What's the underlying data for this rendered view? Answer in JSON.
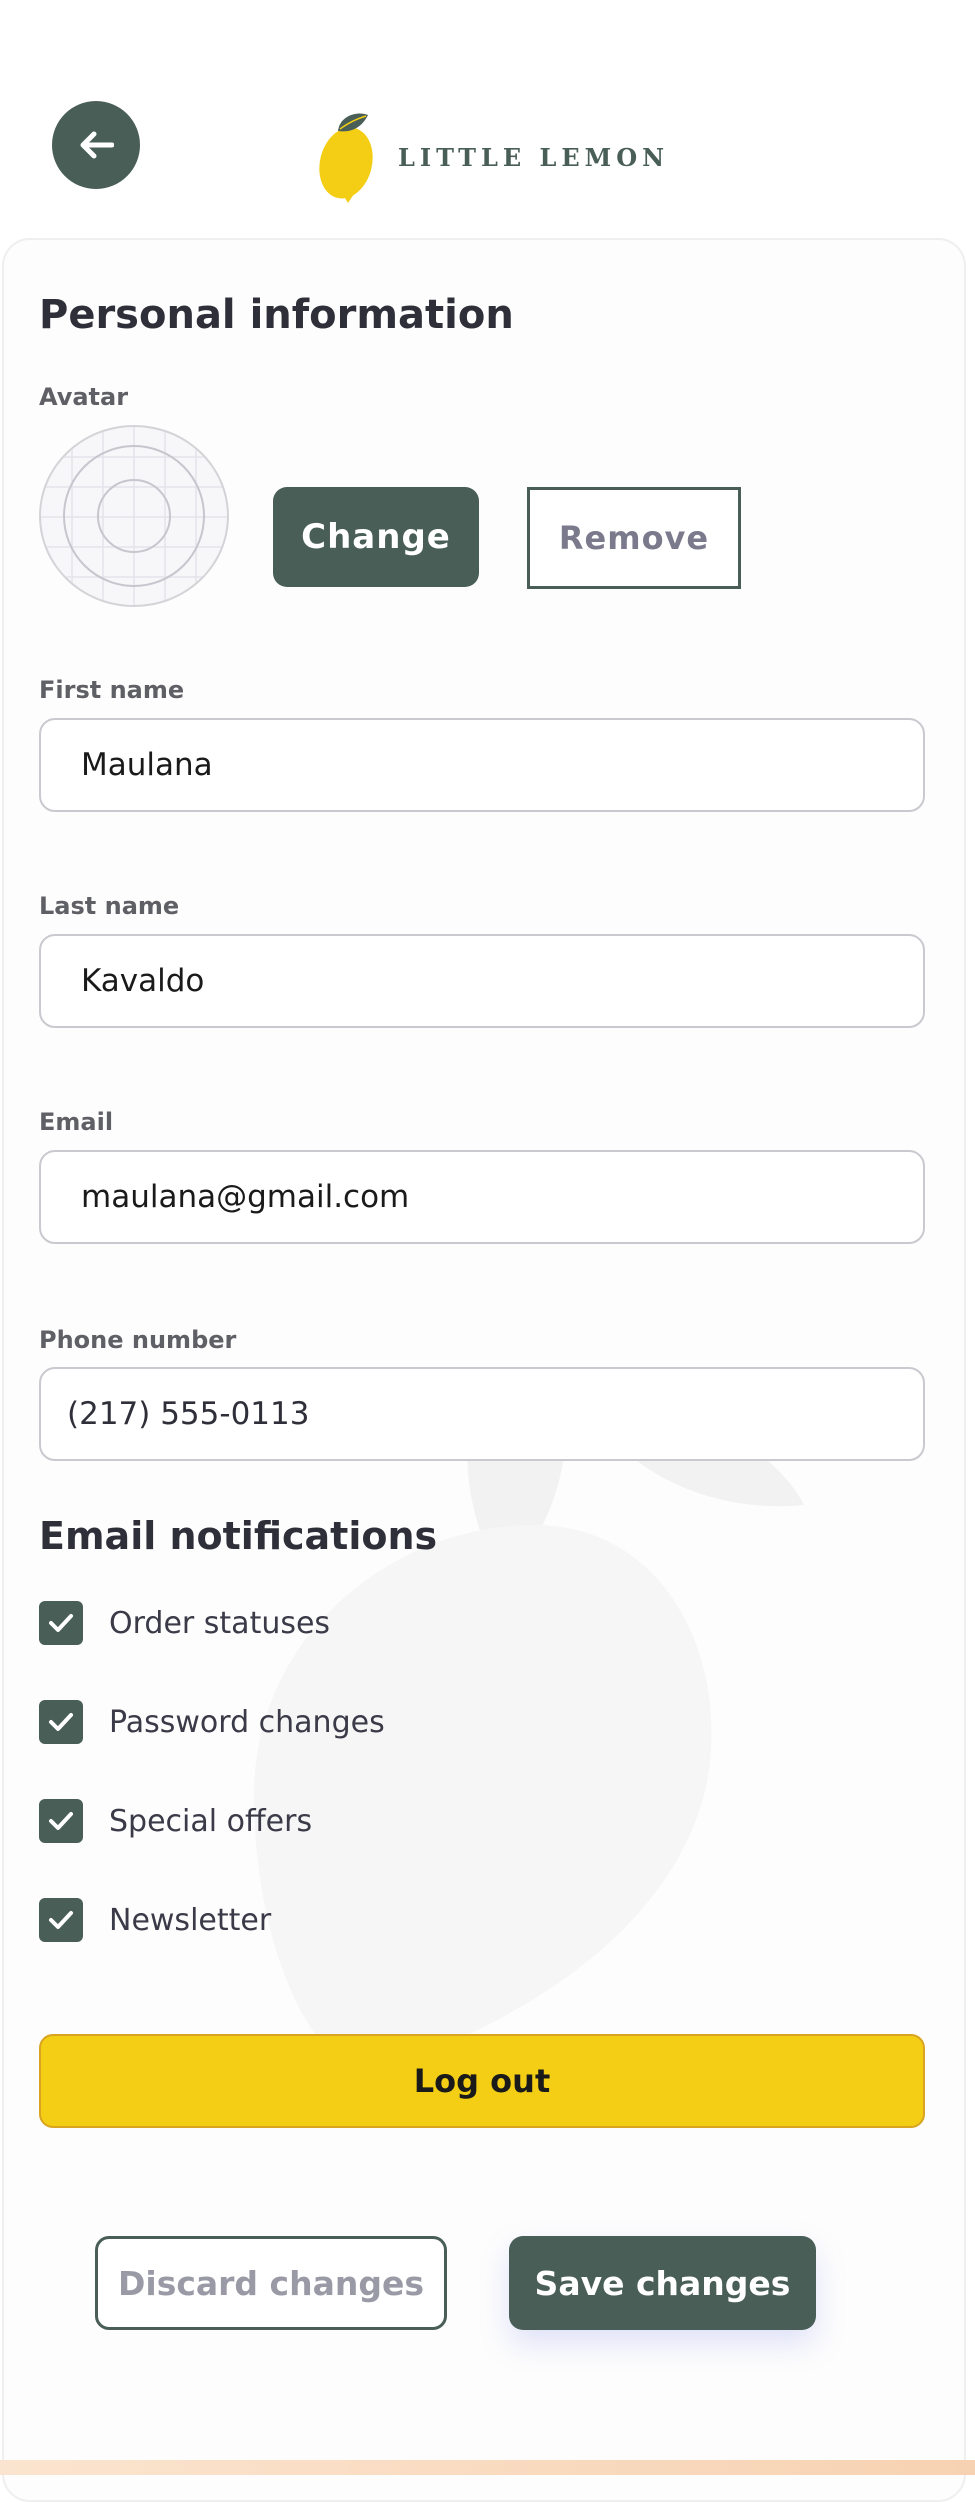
{
  "header": {
    "back_icon": "arrow-left-icon",
    "logo_text": "LITTLE LEMON"
  },
  "profile": {
    "title": "Personal information",
    "avatar_label": "Avatar",
    "change_label": "Change",
    "remove_label": "Remove",
    "fields": [
      {
        "label": "First name",
        "value": "Maulana"
      },
      {
        "label": "Last name",
        "value": "Kavaldo"
      },
      {
        "label": "Email",
        "value": "maulana@gmail.com"
      },
      {
        "label": "Phone number",
        "value": "(217) 555-0113"
      }
    ]
  },
  "notifications": {
    "title": "Email notifications",
    "items": [
      {
        "label": "Order statuses",
        "checked": true
      },
      {
        "label": "Password changes",
        "checked": true
      },
      {
        "label": "Special offers",
        "checked": true
      },
      {
        "label": "Newsletter",
        "checked": true
      }
    ]
  },
  "actions": {
    "logout_label": "Log out",
    "discard_label": "Discard changes",
    "save_label": "Save changes"
  },
  "colors": {
    "primary": "#495e57",
    "yellow": "#f4ce14"
  }
}
